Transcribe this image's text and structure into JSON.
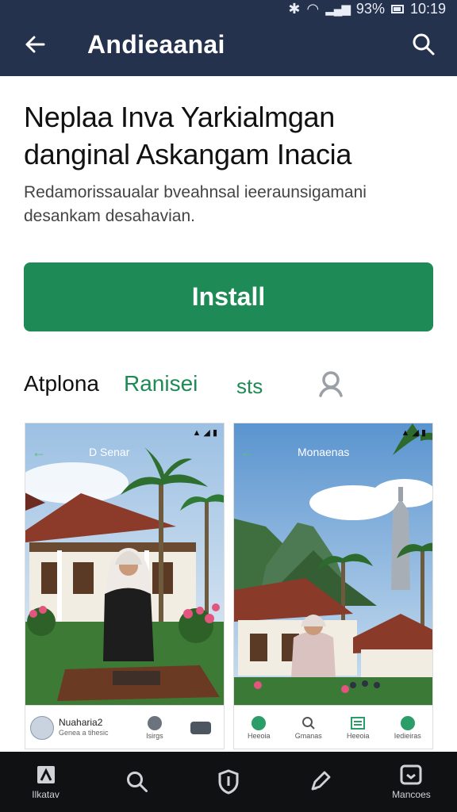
{
  "status": {
    "battery": "93%",
    "time": "10:19"
  },
  "appbar": {
    "title": "Andieaanai",
    "back_icon": "arrow-left-icon",
    "search_icon": "search-icon"
  },
  "headline": "Neplaa Inva Yarkialmgan danginal Askangam Inacia",
  "description": "Redamorissaualar bveahnsal ieeraunsigamani desankam desahavian.",
  "install_label": "Install",
  "tabs": [
    {
      "label": "Atplona"
    },
    {
      "label": "Ranisei"
    },
    {
      "label": "sts"
    }
  ],
  "screenshots": [
    {
      "status_icons": "▲ ◢ ▮",
      "header_title": "D Senar",
      "footer": {
        "name": "Nuaharia2",
        "subtitle": "Genea a tihesic",
        "item2": "Isirgs"
      }
    },
    {
      "status_icons": "▲ ◢ ▮",
      "header_title": "Monaenas",
      "footer": {
        "item1": "Heeoia",
        "item2": "Gmanas",
        "item3": "Heeoia",
        "item4": "Iedieiras"
      }
    }
  ],
  "bottom_nav": [
    {
      "label": "Ilkatav",
      "icon": "library-icon"
    },
    {
      "label": "",
      "icon": "search-icon"
    },
    {
      "label": "",
      "icon": "shield-icon"
    },
    {
      "label": "",
      "icon": "pen-icon"
    },
    {
      "label": "Mancoes",
      "icon": "inbox-icon"
    }
  ],
  "colors": {
    "appbar": "#25324d",
    "accent": "#1e8a55",
    "bottom_nav": "#101112"
  }
}
